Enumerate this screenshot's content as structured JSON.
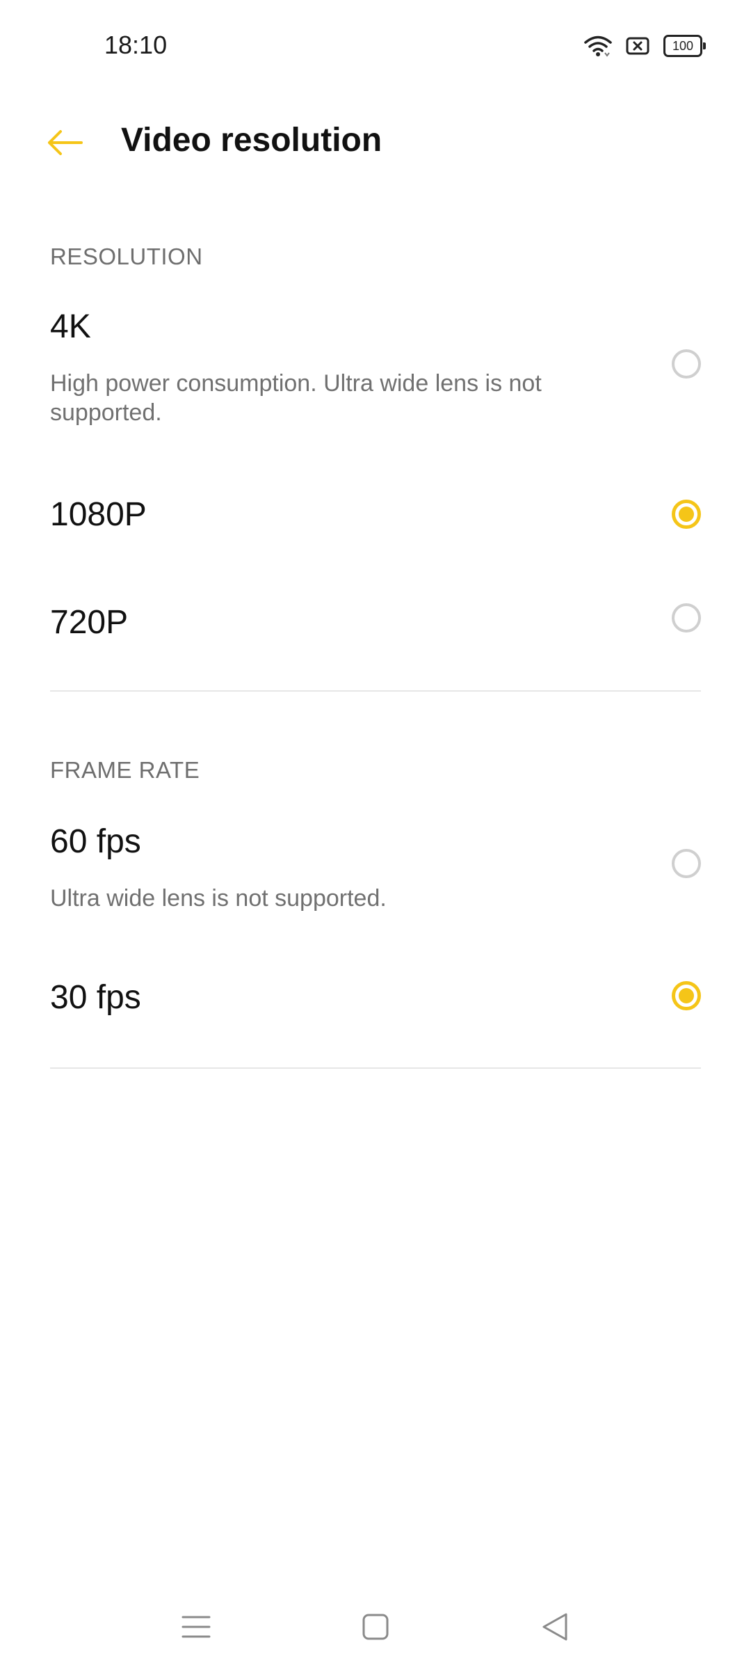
{
  "status_bar": {
    "time": "18:10",
    "battery": "100",
    "icons": [
      "wifi-icon",
      "no-sim-icon",
      "battery-icon"
    ]
  },
  "header": {
    "title": "Video resolution",
    "back_icon": "arrow-left-icon"
  },
  "colors": {
    "accent": "#f5c518",
    "unchecked": "#cfcfcf",
    "section_text": "#6e6e6e",
    "desc_text": "#707070"
  },
  "resolution": {
    "header": "RESOLUTION",
    "options": [
      {
        "label": "4K",
        "description": "High power consumption. Ultra wide lens is not supported.",
        "selected": false
      },
      {
        "label": "1080P",
        "description": "",
        "selected": true
      },
      {
        "label": "720P",
        "description": "",
        "selected": false
      }
    ]
  },
  "frame_rate": {
    "header": "FRAME RATE",
    "options": [
      {
        "label": "60 fps",
        "description": "Ultra wide lens is not supported.",
        "selected": false
      },
      {
        "label": "30 fps",
        "description": "",
        "selected": true
      }
    ]
  },
  "nav_bar": {
    "icons": [
      "menu-icon",
      "home-icon",
      "back-icon"
    ]
  }
}
